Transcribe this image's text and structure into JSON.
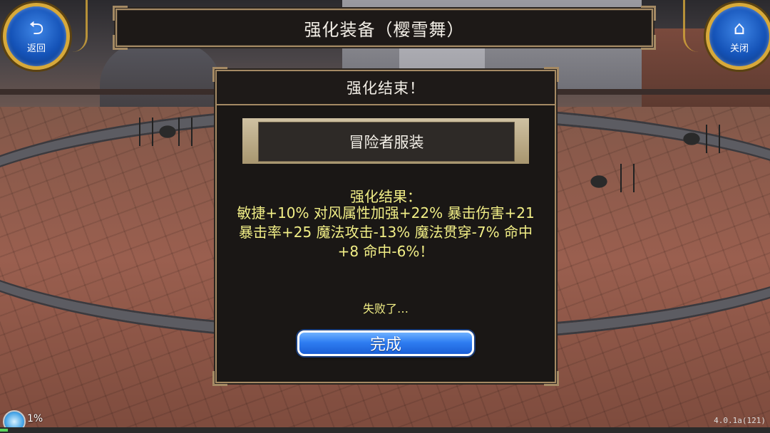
{
  "header": {
    "title": "强化装备（樱雪舞）",
    "back_label": "返回",
    "back_icon": "back-arrow-icon",
    "close_label": "关闭",
    "close_icon": "home-icon"
  },
  "dialog": {
    "title": "强化结束！",
    "item_name": "冒险者服装",
    "result_title": "强化结果：",
    "result_text": "敏捷+10% 对风属性加强+22% 暴击伤害+21 暴击率+25 魔法攻击-13% 魔法贯穿-7% 命中+8 命中-6%！",
    "fail_text": "失败了…",
    "done_label": "完成"
  },
  "status": {
    "progress_percent": 1,
    "progress_text": "1%",
    "version": "4.0.1a(121)"
  },
  "colors": {
    "accent_gold": "#a58a64",
    "result_text": "#f1ee86",
    "button_blue": "#2f7ef2"
  }
}
